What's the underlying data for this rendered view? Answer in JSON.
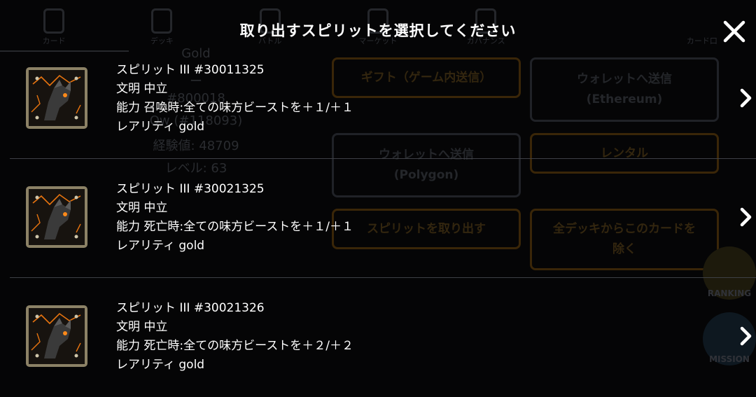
{
  "dialog": {
    "title": "取り出すスピリットを選択してください"
  },
  "spirits": [
    {
      "name": "スピリット III #30011325",
      "civilization_label": "文明",
      "civilization": "中立",
      "ability_label": "能力",
      "ability": "召喚時:全ての味方ビーストを＋１/＋１",
      "rarity_label": "レアリティ",
      "rarity": "gold"
    },
    {
      "name": "スピリット III #30021325",
      "civilization_label": "文明",
      "civilization": "中立",
      "ability_label": "能力",
      "ability": "死亡時:全ての味方ビーストを＋１/＋１",
      "rarity_label": "レアリティ",
      "rarity": "gold"
    },
    {
      "name": "スピリット III #30021326",
      "civilization_label": "文明",
      "civilization": "中立",
      "ability_label": "能力",
      "ability": "死亡時:全ての味方ビーストを＋２/＋２",
      "rarity_label": "レアリティ",
      "rarity": "gold"
    }
  ],
  "background": {
    "nav": [
      "カード",
      "デッキ",
      "バトル",
      "マーケット",
      "ガバナンス",
      "",
      "カード口"
    ],
    "card_info": [
      "Gold",
      "ー",
      "#800018",
      "Ow (#118093)",
      "経験値: 48709",
      "レベル: 63"
    ],
    "buttons": {
      "gift": "ギフト（ゲーム内送信）",
      "wallet_eth": "ウォレットへ送信\n(Ethereum)",
      "wallet_polygon": "ウォレットへ送信\n(Polygon)",
      "rental": "レンタル",
      "extract_spirit": "スピリットを取り出す",
      "remove_from_decks": "全デッキからこのカードを\n除く"
    },
    "side": {
      "ranking": "RANKING",
      "mission": "MISSION"
    }
  },
  "colors": {
    "overlay_text": "#ffffff",
    "separator": "#3e4046",
    "thumb_frame": "#8c8266",
    "accent_orange": "#e8740f"
  },
  "icons": {
    "close": "close-icon",
    "chevron": "chevron-right-icon",
    "thumbnail": "spirit-beast-icon"
  }
}
